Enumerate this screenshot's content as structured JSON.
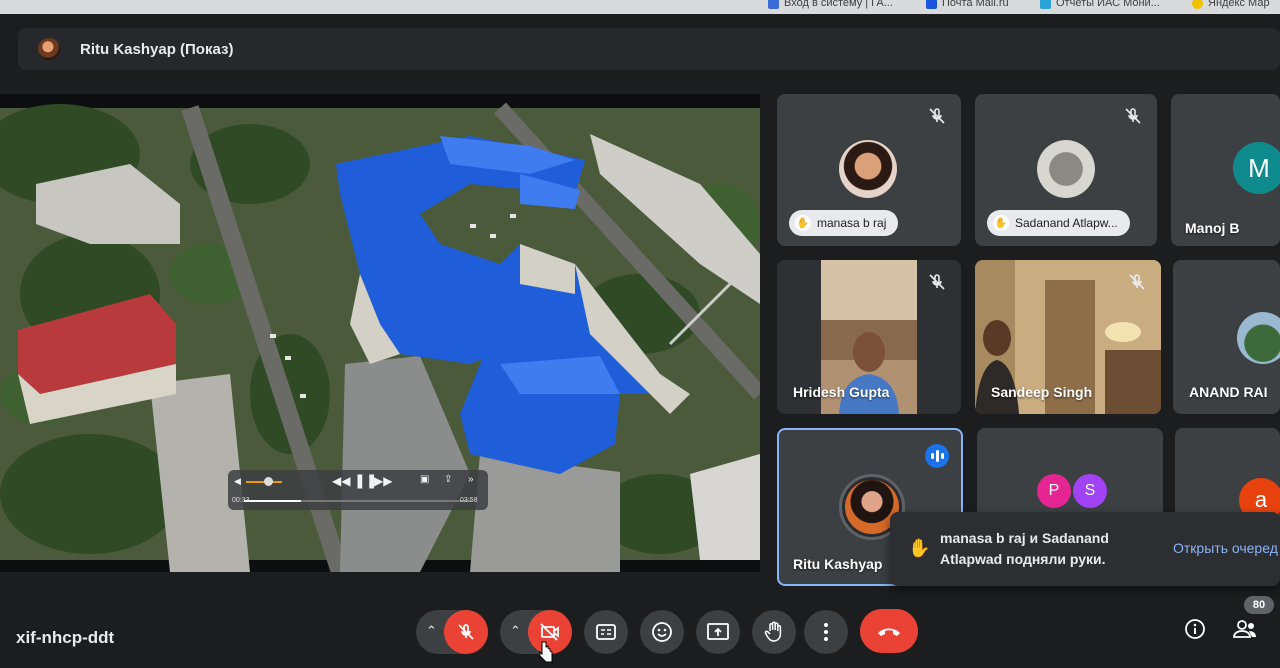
{
  "browser_bookmarks": [
    {
      "label": "Вход в систему | ГА...",
      "color": "#3c6ad6"
    },
    {
      "label": "Почта Mail.ru",
      "color": "#1a56db"
    },
    {
      "label": "Отчеты ИАС Мони...",
      "color": "#28a4d8"
    },
    {
      "label": "Яндекс Мар",
      "color": "#f2c200"
    }
  ],
  "presenter": {
    "name": "Ritu Kashyap (Показ)"
  },
  "video_player": {
    "elapsed": "00:33",
    "duration": "03:58",
    "progress": 0.25
  },
  "participants": [
    {
      "id": "manasa",
      "name": "manasa b raj",
      "hand_raised": true,
      "muted": true,
      "avatar_type": "photo"
    },
    {
      "id": "sadanand",
      "name": "Sadanand Atlapw...",
      "hand_raised": true,
      "muted": true,
      "avatar_type": "photo"
    },
    {
      "id": "manoj",
      "name": "Manoj B",
      "initial": "M",
      "avatar_color": "#0f8b8d"
    },
    {
      "id": "hridesh",
      "name": "Hridesh Gupta",
      "muted": true,
      "avatar_type": "video"
    },
    {
      "id": "sandeep",
      "name": "Sandeep Singh",
      "muted": true,
      "avatar_type": "video"
    },
    {
      "id": "anand",
      "name": "ANAND RAI",
      "avatar_type": "photo"
    },
    {
      "id": "ritu",
      "name": "Ritu Kashyap",
      "speaking": true,
      "avatar_type": "photo"
    },
    {
      "id": "ps",
      "initials": [
        "P",
        "S"
      ],
      "colors": [
        "#e52592",
        "#a142f4"
      ]
    },
    {
      "id": "a",
      "initial": "a",
      "avatar_color": "#e8430f"
    }
  ],
  "notification": {
    "message": "manasa b raj и Sadanand Atlapwad подняли руки.",
    "action": "Открыть очеред"
  },
  "toolbar": {
    "meeting_code": "xif-nhcp-ddt",
    "participant_count": "80"
  },
  "icons": {
    "mic_off": "mic-off-icon",
    "cam_off": "videocam-off-icon",
    "captions": "captions-icon",
    "emoji": "emoji-icon",
    "present": "present-icon",
    "hand": "raise-hand-icon",
    "more": "more-vert-icon",
    "hangup": "call-end-icon",
    "info": "info-icon",
    "people": "people-icon"
  }
}
